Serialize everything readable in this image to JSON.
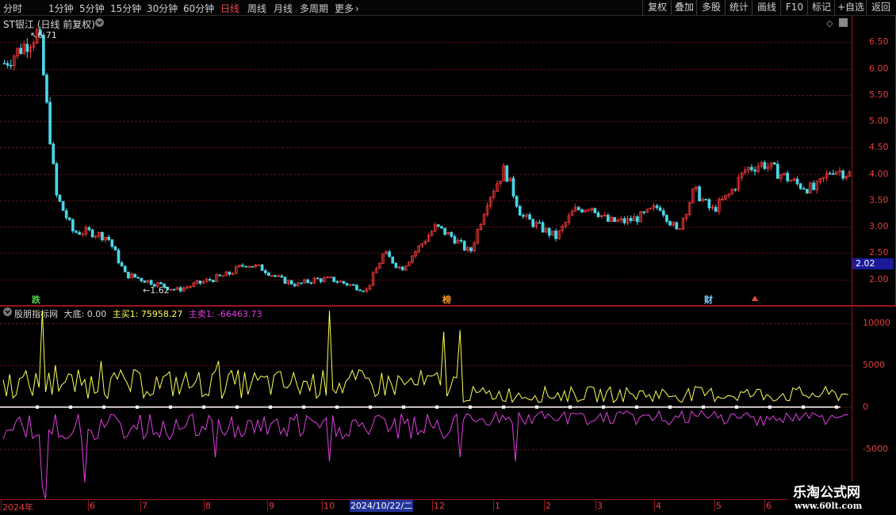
{
  "toolbar": {
    "timeframes": [
      "分时",
      "1分钟",
      "5分钟",
      "15分钟",
      "30分钟",
      "60分钟",
      "日线",
      "周线",
      "月线",
      "多周期",
      "更多"
    ],
    "more_arrow": "›",
    "buttons": [
      "复权",
      "叠加",
      "多股",
      "统计",
      "画线",
      "F10",
      "标记",
      "+自选",
      "返回"
    ]
  },
  "main_panel": {
    "title": "ST银江 (日线 前复权)",
    "high_label": "6.71",
    "low_label": "1.62",
    "current_price": "2.02",
    "tags": [
      "跌",
      "榜",
      "财"
    ],
    "y_labels": [
      "6.50",
      "6.00",
      "5.50",
      "5.00",
      "4.50",
      "4.00",
      "3.50",
      "3.00",
      "2.50",
      "2.00"
    ]
  },
  "indicator_panel": {
    "title": "股朋指标网",
    "da_di_label": "大底: 0.00",
    "buy_label": "主买1: 75958.27",
    "sell_label": "主卖1: -66463.73",
    "y_labels": [
      "10000",
      "5000",
      "0",
      "-5000"
    ]
  },
  "x_axis": {
    "labels": [
      "2024年",
      "6",
      "7",
      "8",
      "9",
      "10",
      "12",
      "1",
      "2",
      "3",
      "4",
      "5",
      "6"
    ],
    "cursor_date": "2024/10/22/二"
  },
  "watermark": {
    "line1": "乐淘公式网",
    "line2": "www.60lt.com"
  },
  "colors": {
    "up": "#ff3b3b",
    "down": "#49d6e6",
    "buy": "#ffff55",
    "sell": "#e040e0",
    "axis": "#e04040"
  },
  "chart_data": {
    "type": "candlestick",
    "title": "ST银江 (日线 前复权)",
    "price_axis": {
      "ticks": [
        6.5,
        6.0,
        5.5,
        5.0,
        4.5,
        4.0,
        3.5,
        3.0,
        2.5,
        2.0
      ],
      "ylim": [
        1.5,
        7.0
      ]
    },
    "approx_close_path": [
      6.1,
      6.4,
      6.7,
      3.6,
      2.9,
      2.9,
      2.8,
      2.1,
      2.0,
      1.9,
      1.8,
      1.9,
      2.0,
      2.1,
      2.3,
      2.2,
      2.0,
      1.9,
      2.0,
      2.0,
      1.9,
      1.8,
      2.5,
      2.2,
      2.6,
      3.0,
      2.8,
      2.5,
      3.5,
      4.1,
      3.2,
      3.0,
      2.8,
      3.3,
      3.4,
      3.1,
      3.1,
      3.2,
      3.4,
      2.9,
      3.7,
      3.3,
      3.6,
      4.1,
      4.2,
      4.0,
      3.8,
      3.7,
      4.1,
      4.0
    ],
    "high": 6.71,
    "low": 1.62,
    "indicator": {
      "name": "股朋指标网",
      "ylim": [
        -11000,
        12000
      ],
      "ticks": [
        10000,
        5000,
        0,
        -5000
      ],
      "series": [
        {
          "name": "主买1",
          "value_label": "75958.27"
        },
        {
          "name": "主卖1",
          "value_label": "-66463.73"
        }
      ]
    }
  }
}
